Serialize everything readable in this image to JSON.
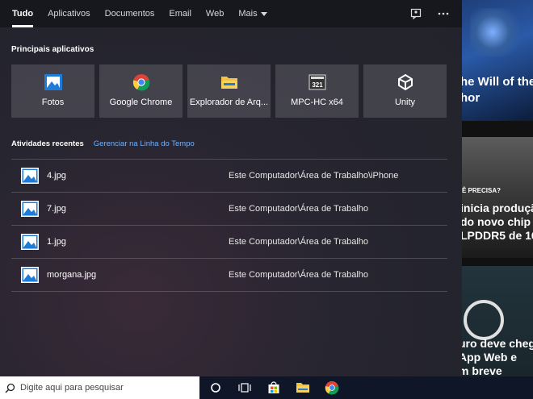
{
  "tabs": [
    {
      "label": "Tudo",
      "active": true
    },
    {
      "label": "Aplicativos"
    },
    {
      "label": "Documentos"
    },
    {
      "label": "Email"
    },
    {
      "label": "Web"
    },
    {
      "label": "Mais"
    }
  ],
  "tools": {
    "feedback_icon": "feedback-icon",
    "more_icon": "more-options-icon"
  },
  "top_apps": {
    "title": "Principais aplicativos",
    "items": [
      {
        "label": "Fotos",
        "icon": "photos-icon"
      },
      {
        "label": "Google Chrome",
        "icon": "chrome-icon"
      },
      {
        "label": "Explorador de Arq...",
        "icon": "file-explorer-icon"
      },
      {
        "label": "MPC-HC x64",
        "icon": "mpc-hc-icon"
      },
      {
        "label": "Unity",
        "icon": "unity-icon"
      }
    ]
  },
  "recent": {
    "title": "Atividades recentes",
    "link": "Gerenciar na Linha do Tempo",
    "items": [
      {
        "name": "4.jpg",
        "path": "Este Computador\\Área de Trabalho\\iPhone"
      },
      {
        "name": "7.jpg",
        "path": "Este Computador\\Área de Trabalho"
      },
      {
        "name": "1.jpg",
        "path": "Este Computador\\Área de Trabalho"
      },
      {
        "name": "morgana.jpg",
        "path": "Este Computador\\Área de Trabalho"
      }
    ]
  },
  "background": {
    "headline_1": "he Will of the\nhor",
    "tag_2": "Ê PRECISA?",
    "headline_2": "inicia produçã\ndo novo chip\nLPDDR5 de 16",
    "headline_3": "uro deve chega\nApp Web e\nm breve"
  },
  "taskbar": {
    "search_placeholder": "Digite aqui para pesquisar",
    "icons": [
      "cortana-icon",
      "task-view-icon",
      "store-icon",
      "file-explorer-icon",
      "chrome-icon"
    ]
  },
  "colors": {
    "accent_link": "#6fb1ff",
    "taskbar": "#0f1627",
    "panel": "#22232b"
  }
}
